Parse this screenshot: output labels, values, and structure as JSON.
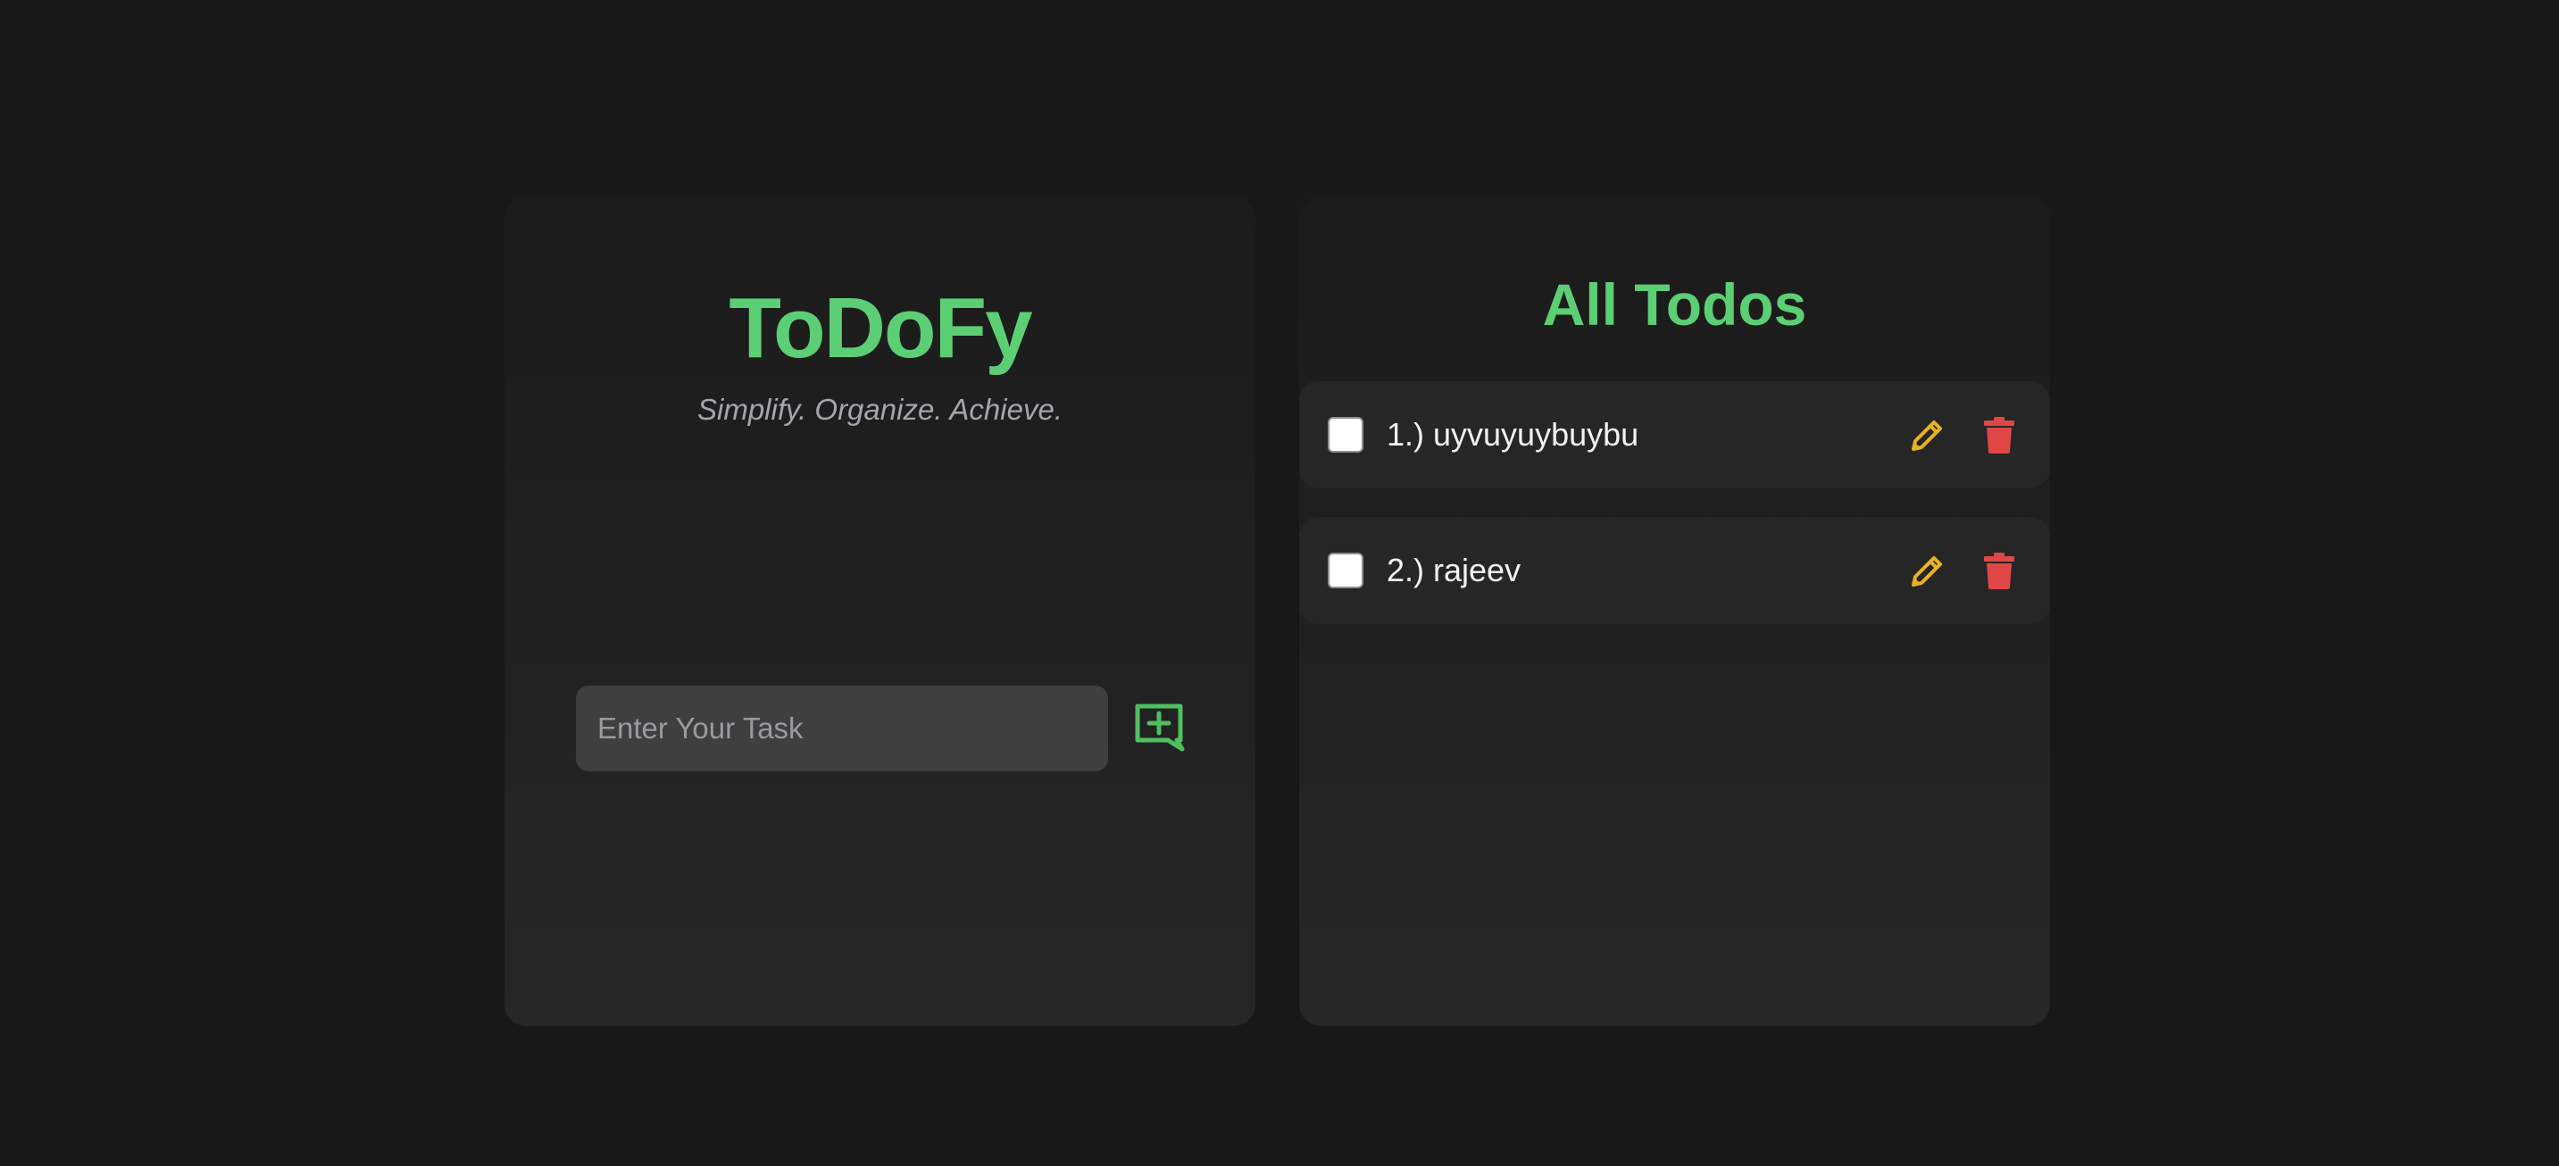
{
  "colors": {
    "background": "#181818",
    "accent": "#5ccf74",
    "edit": "#eab221",
    "delete": "#e04848"
  },
  "composer": {
    "title": "ToDoFy",
    "tagline": "Simplify. Organize. Achieve.",
    "input_placeholder": "Enter Your Task",
    "input_value": "",
    "add_icon": "add-comment-icon"
  },
  "todos": {
    "heading": "All Todos",
    "items": [
      {
        "label": "1.) uyvuyuybuybu",
        "checked": false,
        "edit_icon": "pencil-icon",
        "delete_icon": "trash-icon"
      },
      {
        "label": "2.) rajeev",
        "checked": false,
        "edit_icon": "pencil-icon",
        "delete_icon": "trash-icon"
      }
    ]
  }
}
